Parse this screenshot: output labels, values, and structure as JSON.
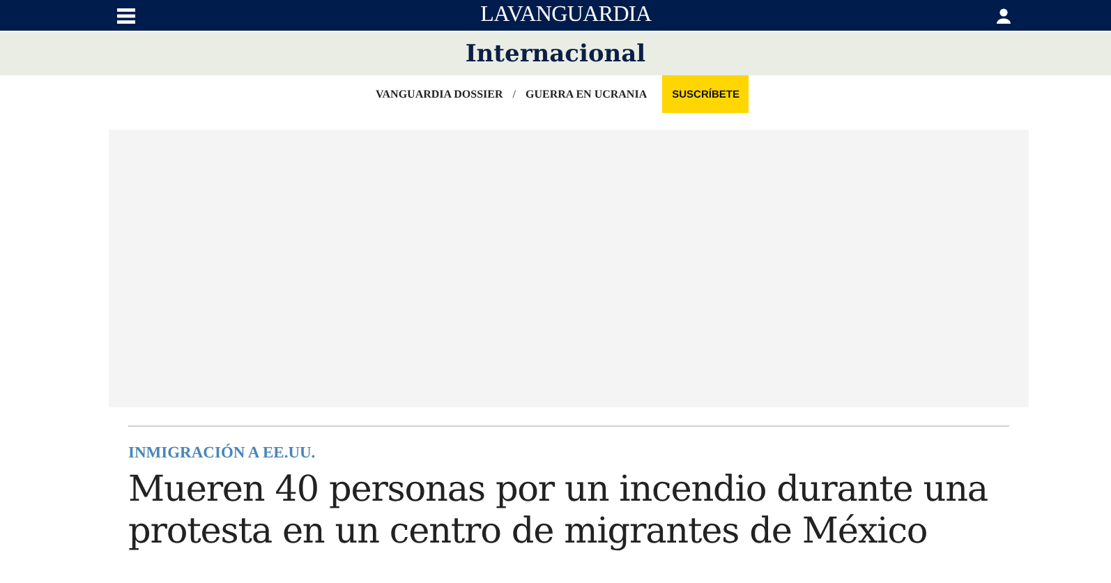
{
  "header": {
    "logo": "LA VANGUARDIA"
  },
  "section": {
    "title": "Internacional"
  },
  "nav": {
    "links": [
      "VANGUARDIA DOSSIER",
      "GUERRA EN UCRANIA"
    ],
    "separator": "/",
    "subscribe": "SUSCRÍBETE"
  },
  "article": {
    "kicker": "INMIGRACIÓN A EE.UU.",
    "headline": "Mueren 40 personas por un incendio durante una protesta en un centro de migrantes de México"
  }
}
